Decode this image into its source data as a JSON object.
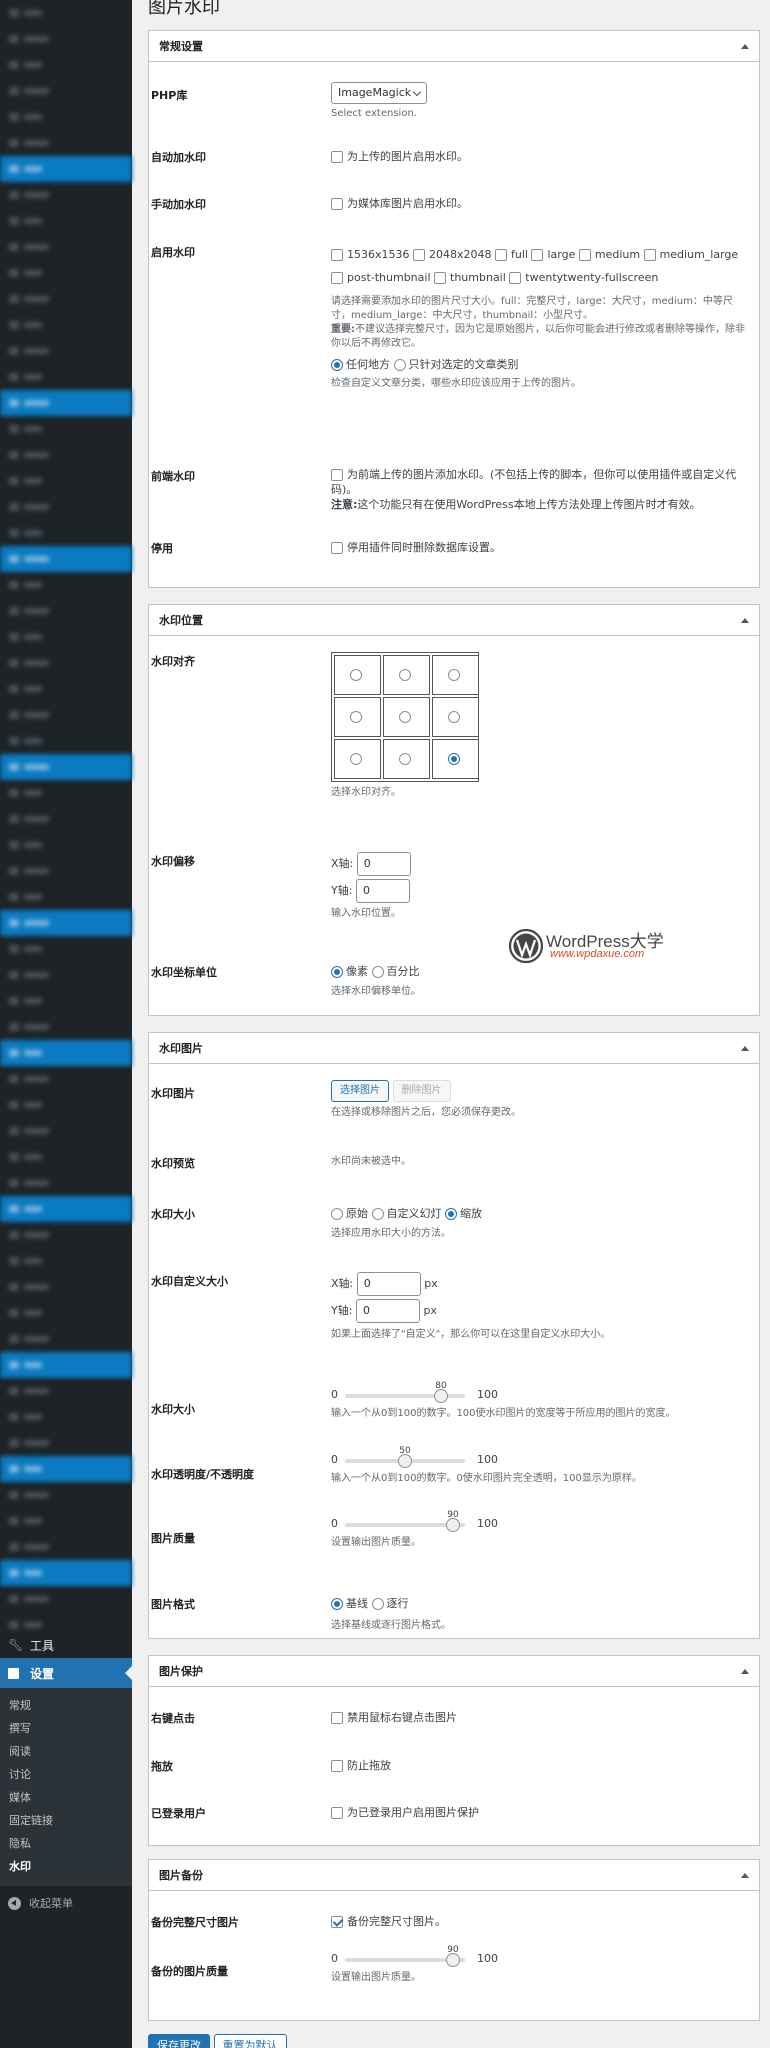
{
  "page_title": "图片水印",
  "sidebar": {
    "tools": "工具",
    "settings": "设置",
    "submenu": [
      "常规",
      "撰写",
      "阅读",
      "讨论",
      "媒体",
      "固定链接",
      "隐私",
      "水印"
    ],
    "collapse": "收起菜单"
  },
  "general": {
    "title": "常规设置",
    "php_lib": {
      "label": "PHP库",
      "value": "ImageMagick",
      "desc": "Select extension."
    },
    "auto": {
      "label": "自动加水印",
      "text": "为上传的图片启用水印。"
    },
    "manual": {
      "label": "手动加水印",
      "text": "为媒体库图片启用水印。"
    },
    "enable": {
      "label": "启用水印",
      "sizes": [
        "1536x1536",
        "2048x2048",
        "full",
        "large",
        "medium",
        "medium_large",
        "post-thumbnail",
        "thumbnail",
        "twentytwenty-fullscreen"
      ],
      "desc1": "请选择需要添加水印的图片尺寸大小。full：完整尺寸，large：大尺寸，medium：中等尺寸，medium_large：中大尺寸，thumbnail：小型尺寸。",
      "desc2_bold": "重要:",
      "desc2": "不建议选择完整尺寸，因为它是原始图片，以后你可能会进行修改或者删除等操作，除非你以后不再修改它。",
      "opt_any": "任何地方",
      "opt_cat": "只针对选定的文章类别",
      "desc3": "检查自定义文章分类，哪些水印应该应用于上传的图片。"
    },
    "frontend": {
      "label": "前端水印",
      "text": "为前端上传的图片添加水印。(不包括上传的脚本，但你可以使用插件或自定义代码)。",
      "note_bold": "注意:",
      "note": "这个功能只有在使用WordPress本地上传方法处理上传图片时才有效。"
    },
    "disable": {
      "label": "停用",
      "text": "停用插件同时删除数据库设置。"
    }
  },
  "position": {
    "title": "水印位置",
    "align": {
      "label": "水印对齐",
      "desc": "选择水印对齐。",
      "selected_index": 8
    },
    "offset": {
      "label": "水印偏移",
      "x_label": "X轴:",
      "x_value": "0",
      "y_label": "Y轴:",
      "y_value": "0",
      "desc": "输入水印位置。"
    },
    "unit": {
      "label": "水印坐标单位",
      "opt_px": "像素",
      "opt_pct": "百分比",
      "desc": "选择水印偏移单位。"
    }
  },
  "logo": {
    "name": "WordPress大学",
    "url": "www.wpdaxue.com"
  },
  "image": {
    "title": "水印图片",
    "img": {
      "label": "水印图片",
      "select": "选择图片",
      "remove": "删除图片",
      "desc": "在选择或移除图片之后，您必须保存更改。"
    },
    "preview": {
      "label": "水印预览",
      "text": "水印尚未被选中。"
    },
    "size": {
      "label": "水印大小",
      "opt1": "原始",
      "opt2": "自定义幻灯",
      "opt3": "缩放",
      "desc": "选择应用水印大小的方法。"
    },
    "custom": {
      "label": "水印自定义大小",
      "x_label": "X轴:",
      "x_value": "0",
      "y_label": "Y轴:",
      "y_value": "0",
      "unit": "px",
      "desc": "如果上面选择了\"自定义\"，那么你可以在这里自定义水印大小。"
    },
    "scale": {
      "label": "水印大小",
      "min": "0",
      "max": "100",
      "value": 80,
      "value_text": "80",
      "desc": "输入一个从0到100的数字。100使水印图片的宽度等于所应用的图片的宽度。"
    },
    "opacity": {
      "label": "水印透明度/不透明度",
      "min": "0",
      "max": "100",
      "value": 50,
      "value_text": "50",
      "desc": "输入一个从0到100的数字。0使水印图片完全透明，100显示为原样。"
    },
    "quality": {
      "label": "图片质量",
      "min": "0",
      "max": "100",
      "value": 90,
      "value_text": "90",
      "desc": "设置输出图片质量。"
    },
    "format": {
      "label": "图片格式",
      "opt1": "基线",
      "opt2": "逐行",
      "desc": "选择基线或逐行图片格式。"
    }
  },
  "protection": {
    "title": "图片保护",
    "rightclick": {
      "label": "右键点击",
      "text": "禁用鼠标右键点击图片"
    },
    "drag": {
      "label": "拖放",
      "text": "防止拖放"
    },
    "loggedin": {
      "label": "已登录用户",
      "text": "为已登录用户启用图片保护"
    }
  },
  "backup": {
    "title": "图片备份",
    "full": {
      "label": "备份完整尺寸图片",
      "text": "备份完整尺寸图片。"
    },
    "quality": {
      "label": "备份的图片质量",
      "min": "0",
      "max": "100",
      "value": 90,
      "value_text": "90",
      "desc": "设置输出图片质量。"
    }
  },
  "buttons": {
    "save": "保存更改",
    "reset": "重置为默认"
  },
  "colors": {
    "primary": "#2271b1",
    "sidebar": "#1d2327"
  }
}
